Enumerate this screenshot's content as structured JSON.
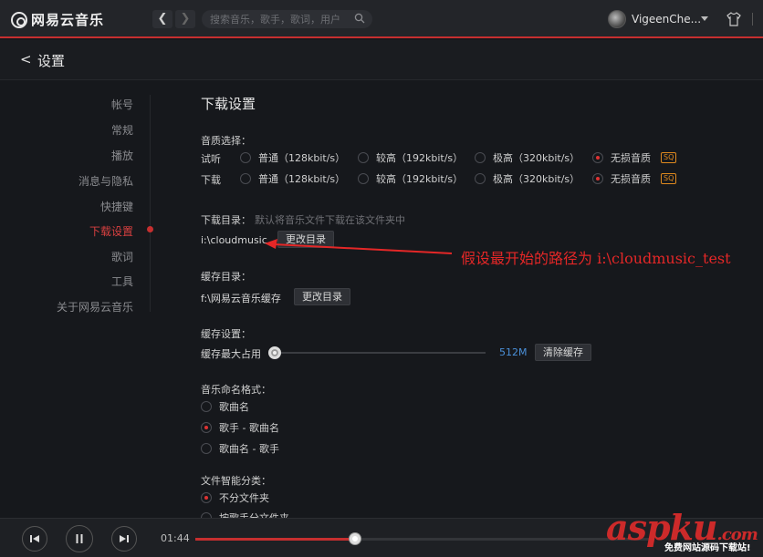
{
  "app": {
    "brand": "网易云音乐"
  },
  "search": {
    "placeholder": "搜索音乐，歌手，歌词，用户"
  },
  "user": {
    "name": "VigeenChe..."
  },
  "page": {
    "back": "<",
    "title": "设置"
  },
  "nav": {
    "items": [
      "帐号",
      "常规",
      "播放",
      "消息与隐私",
      "快捷键",
      "下载设置",
      "歌词",
      "工具",
      "关于网易云音乐"
    ],
    "active_index": 5
  },
  "download": {
    "title": "下载设置",
    "quality": {
      "label": "音质选择：",
      "rows": [
        {
          "label": "试听",
          "options": [
            "普通（128kbit/s）",
            "较高（192kbit/s）",
            "极高（320kbit/s）",
            "无损音质"
          ],
          "selected": 3
        },
        {
          "label": "下载",
          "options": [
            "普通（128kbit/s）",
            "较高（192kbit/s）",
            "极高（320kbit/s）",
            "无损音质"
          ],
          "selected": 3
        }
      ],
      "badge": "SQ"
    },
    "dir": {
      "label": "下载目录：",
      "hint": "默认将音乐文件下载在该文件夹中",
      "path": "i:\\cloudmusic",
      "button": "更改目录"
    },
    "cache_dir": {
      "label": "缓存目录：",
      "path": "f:\\网易云音乐缓存",
      "button": "更改目录"
    },
    "cache_settings": {
      "label": "缓存设置：",
      "max_label": "缓存最大占用",
      "size": "512M",
      "level": 0.0,
      "button": "清除缓存"
    },
    "naming": {
      "label": "音乐命名格式：",
      "options": [
        "歌曲名",
        "歌手 - 歌曲名",
        "歌曲名 - 歌手"
      ],
      "selected": 1
    },
    "classify": {
      "label": "文件智能分类：",
      "options": [
        "不分文件夹",
        "按歌手分文件夹"
      ],
      "selected": 0
    }
  },
  "annotation": {
    "text": "假设最开始的路径为 i:\\cloudmusic_test"
  },
  "player": {
    "time": "01:44",
    "progress": 0.35
  },
  "watermark": {
    "main": "aspku",
    "suffix": ".com",
    "sub": "免费网站源码下载站!"
  },
  "colors": {
    "accent": "#c62f2f",
    "annotation": "#e42727",
    "link": "#4a90d9"
  }
}
